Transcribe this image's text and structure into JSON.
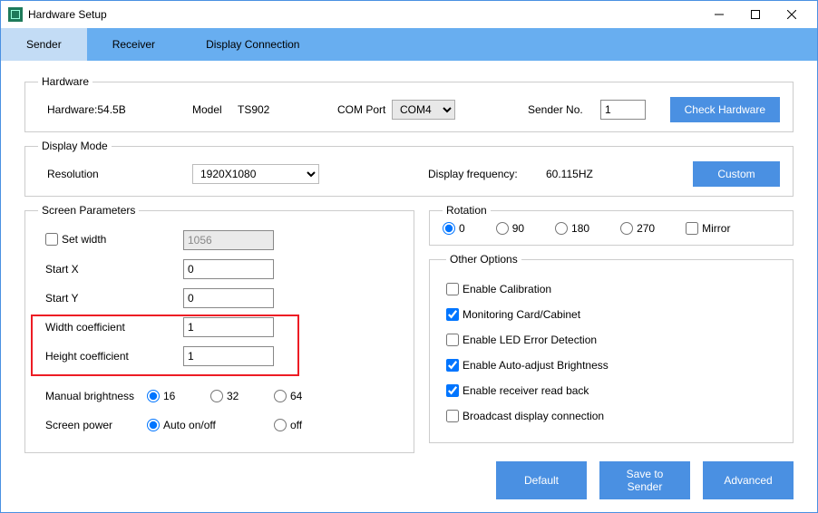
{
  "window": {
    "title": "Hardware Setup"
  },
  "tabs": {
    "sender": "Sender",
    "receiver": "Receiver",
    "display": "Display Connection"
  },
  "hardware": {
    "legend": "Hardware",
    "hw_label": "Hardware:54.5B",
    "model_label": "Model",
    "model_value": "TS902",
    "com_label": "COM Port",
    "com_value": "COM4",
    "sender_no_label": "Sender No.",
    "sender_no_value": "1",
    "check_btn": "Check Hardware"
  },
  "display_mode": {
    "legend": "Display Mode",
    "res_label": "Resolution",
    "res_value": "1920X1080",
    "freq_label": "Display frequency:",
    "freq_value": "60.115HZ",
    "custom_btn": "Custom"
  },
  "screen": {
    "legend": "Screen Parameters",
    "set_width_label": "Set width",
    "set_width_value": "1056",
    "start_x_label": "Start X",
    "start_x_value": "0",
    "start_y_label": "Start Y",
    "start_y_value": "0",
    "w_coef_label": "Width coefficient",
    "w_coef_value": "1",
    "h_coef_label": "Height coefficient",
    "h_coef_value": "1",
    "manual_bright": "Manual brightness",
    "mb16": "16",
    "mb32": "32",
    "mb64": "64",
    "screen_power": "Screen power",
    "auto_on_off": "Auto on/off",
    "off": "off"
  },
  "rotation": {
    "legend": "Rotation",
    "r0": "0",
    "r90": "90",
    "r180": "180",
    "r270": "270",
    "mirror": "Mirror"
  },
  "other": {
    "legend": "Other Options",
    "calib": "Enable Calibration",
    "moncard": "Monitoring Card/Cabinet",
    "leddet": "Enable LED Error Detection",
    "autoadj": "Enable Auto-adjust Brightness",
    "readback": "Enable receiver read back",
    "broadcast": "Broadcast display connection"
  },
  "footer": {
    "default": "Default",
    "save": "Save to Sender",
    "adv": "Advanced"
  }
}
